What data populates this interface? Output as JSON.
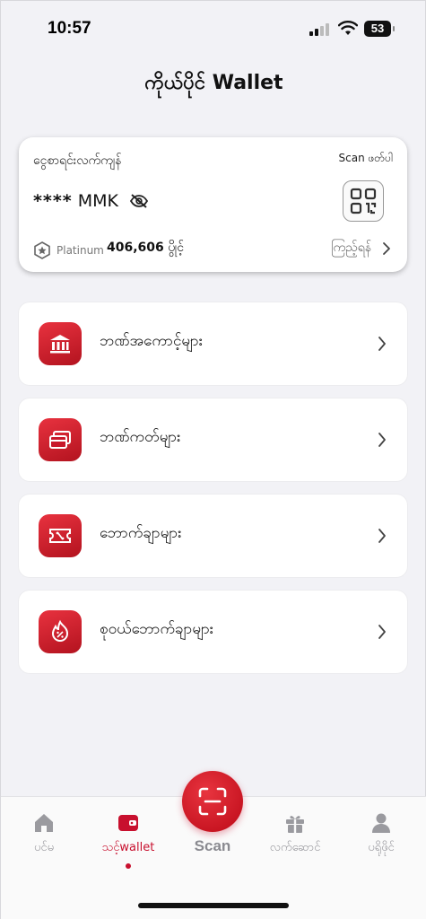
{
  "status_bar": {
    "time": "10:57",
    "battery": "53"
  },
  "header": {
    "title": "ကိုယ်ပိုင် Wallet"
  },
  "wallet_card": {
    "label": "ငွေစာရင်းလက်ကျန်",
    "scan_label": "Scan ဖတ်ပါ",
    "balance_mask": "****",
    "currency": "MMK",
    "tier": "Platinum",
    "points_value": "406,606",
    "points_unit": "ပွိုင့်",
    "view_label": "ကြည့်ရန်"
  },
  "menu": {
    "items": [
      {
        "label": "ဘဏ်အကောင့်များ",
        "icon": "bank-icon"
      },
      {
        "label": "ဘဏ်ကတ်များ",
        "icon": "card-icon"
      },
      {
        "label": "ဘောက်ချာများ",
        "icon": "voucher-icon"
      },
      {
        "label": "စုဝယ်ဘောက်ချာများ",
        "icon": "group-buy-voucher-icon"
      }
    ]
  },
  "bottom_nav": {
    "items": [
      {
        "label": "ပင်မ",
        "icon": "home-icon"
      },
      {
        "label": "သင့်wallet",
        "icon": "wallet-icon",
        "active": true
      },
      {
        "label": "Scan",
        "icon": "scan-icon"
      },
      {
        "label": "လက်ဆောင်",
        "icon": "gift-icon"
      },
      {
        "label": "ပရိုဖိုင်",
        "icon": "profile-icon"
      }
    ]
  },
  "colors": {
    "accent": "#c8102e",
    "background": "#f2f2f6",
    "inactive": "#9a9a9f"
  }
}
